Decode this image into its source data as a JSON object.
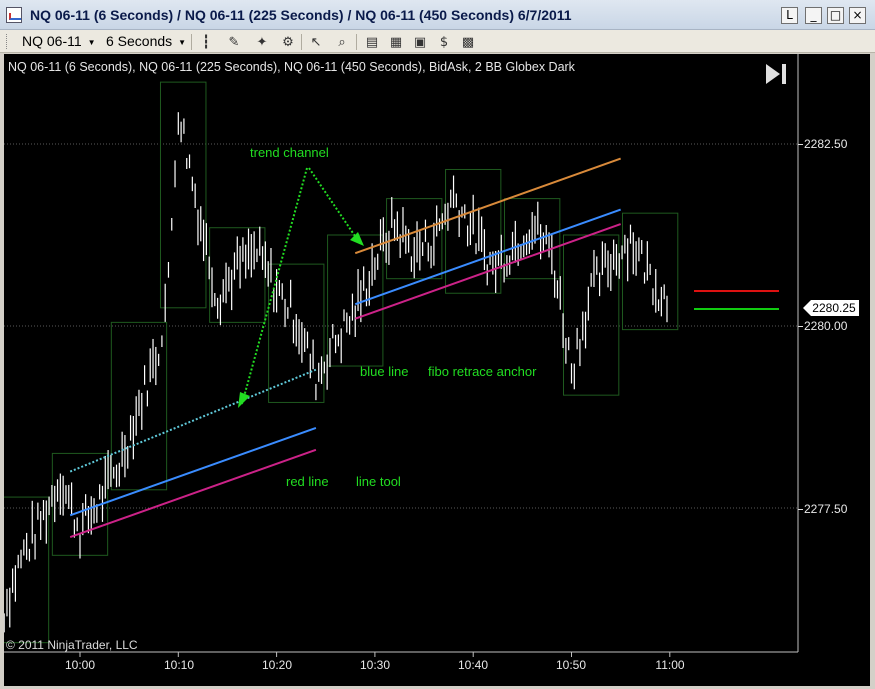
{
  "window": {
    "title": "NQ 06-11 (6 Seconds) / NQ 06-11 (225 Seconds) / NQ 06-11 (450 Seconds)  6/7/2011",
    "buttons": [
      "L",
      "_",
      "□",
      "×"
    ]
  },
  "toolbar": {
    "instrument": "NQ 06-11",
    "interval": "6 Seconds",
    "icons": [
      "bar-type-icon",
      "pencil-draw-icon",
      "indicator-wand-icon",
      "strategy-icon",
      "cursor-icon",
      "zoom-icon",
      "order-ladder-icon",
      "data-box-icon",
      "chart-properties-icon",
      "dollar-icon",
      "grid-icon"
    ]
  },
  "chart": {
    "header": "NQ 06-11 (6 Seconds), NQ 06-11 (225 Seconds), NQ 06-11 (450 Seconds), BidAsk, 2 BB Globex Dark",
    "copyright": "© 2011 NinjaTrader, LLC",
    "current_price": "2280.25",
    "annotations": {
      "trend_channel": "trend channel",
      "blue_line": "blue line",
      "fibo": "fibo retrace anchor",
      "red_line": "red  line",
      "line_tool": "line tool"
    },
    "colors": {
      "background": "#000000",
      "bars": "#ffffff",
      "boxes": "#1f5a1f",
      "blue_line": "#3a8cff",
      "magenta_line": "#cc2288",
      "orange_line": "#d98a3a",
      "annotation_text": "#22dd22",
      "ask_line": "#dd1111",
      "bid_line": "#11cc11"
    }
  },
  "chart_data": {
    "type": "line",
    "title": "",
    "xlabel": "",
    "ylabel": "",
    "x_ticks": [
      "10:00",
      "10:10",
      "10:20",
      "10:30",
      "10:40",
      "10:50",
      "11:00"
    ],
    "y_ticks": [
      "2282.50",
      "2280.00",
      "2277.50"
    ],
    "ylim": [
      2275.3,
      2283.5
    ],
    "xlim_minutes": [
      9.0,
      22.7
    ],
    "series": [
      {
        "x": [
          "09:52",
          "09:54",
          "09:56",
          "09:58",
          "10:00",
          "10:02",
          "10:04",
          "10:06",
          "10:08",
          "10:09",
          "10:10",
          "10:12",
          "10:14",
          "10:16",
          "10:18",
          "10:20",
          "10:22",
          "10:24",
          "10:26",
          "10:28",
          "10:30",
          "10:32",
          "10:34",
          "10:36",
          "10:38",
          "10:40",
          "10:42",
          "10:44",
          "10:46",
          "10:48",
          "10:50",
          "10:52",
          "10:54",
          "10:56",
          "10:58",
          "11:00"
        ],
        "y": [
          2276.0,
          2276.8,
          2277.3,
          2277.9,
          2277.2,
          2277.6,
          2278.1,
          2278.9,
          2279.7,
          2280.6,
          2283.0,
          2281.6,
          2280.4,
          2280.8,
          2281.0,
          2280.5,
          2280.1,
          2279.3,
          2279.8,
          2280.2,
          2280.9,
          2281.4,
          2281.0,
          2281.2,
          2281.8,
          2281.3,
          2280.8,
          2281.1,
          2281.4,
          2281.0,
          2279.4,
          2280.5,
          2280.9,
          2281.2,
          2280.7,
          2280.3
        ]
      }
    ],
    "drawn_lines": [
      {
        "color": "blue",
        "x1": "09:59",
        "y1": 2277.4,
        "x2": "10:24",
        "y2": 2278.6
      },
      {
        "color": "magenta",
        "x1": "09:59",
        "y1": 2277.1,
        "x2": "10:24",
        "y2": 2278.3
      },
      {
        "color": "blue",
        "x1": "10:28",
        "y1": 2280.3,
        "x2": "10:55",
        "y2": 2281.6
      },
      {
        "color": "magenta",
        "x1": "10:28",
        "y1": 2280.1,
        "x2": "10:55",
        "y2": 2281.4
      },
      {
        "color": "orange",
        "x1": "10:28",
        "y1": 2281.0,
        "x2": "10:55",
        "y2": 2282.3
      }
    ]
  }
}
